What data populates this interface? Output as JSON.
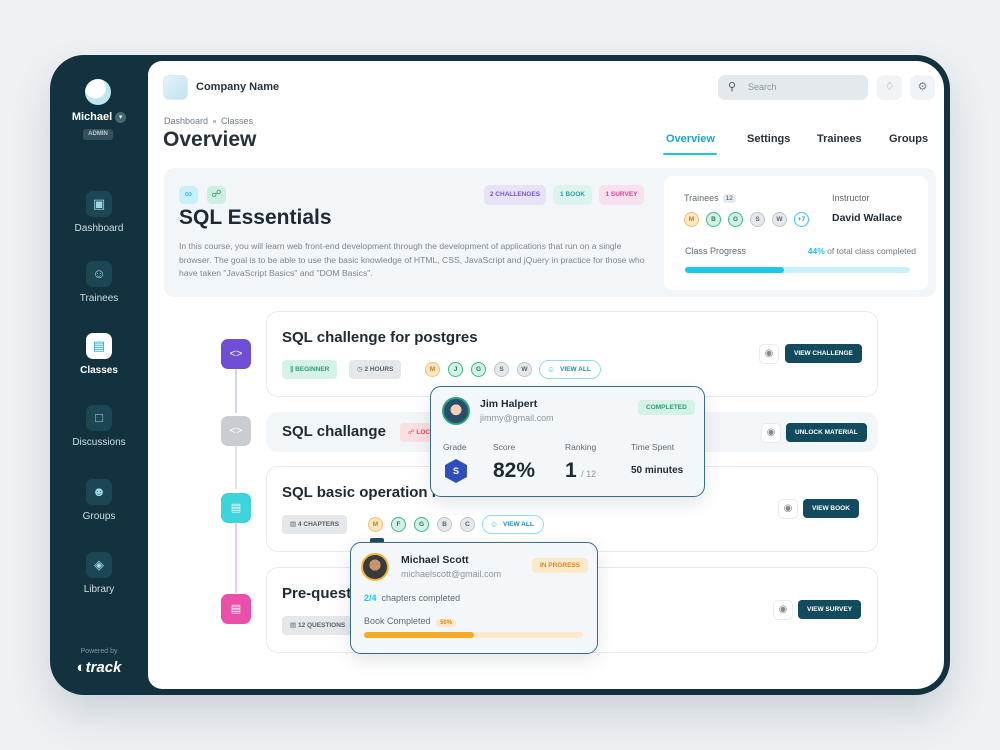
{
  "sidebar": {
    "user": {
      "name": "Michael",
      "role": "ADMIN"
    },
    "items": [
      {
        "label": "Dashboard",
        "icon": "kanban-icon",
        "active": false
      },
      {
        "label": "Trainees",
        "icon": "user-icon",
        "active": false
      },
      {
        "label": "Classes",
        "icon": "book-icon",
        "active": true
      },
      {
        "label": "Discussions",
        "icon": "chat-icon",
        "active": false
      },
      {
        "label": "Groups",
        "icon": "users-icon",
        "active": false
      },
      {
        "label": "Library",
        "icon": "layers-icon",
        "active": false
      }
    ],
    "powered_by": "Powered by",
    "brand": "track"
  },
  "header": {
    "company": "Company Name",
    "search_placeholder": "Search",
    "breadcrumb": [
      "Dashboard",
      "Classes"
    ],
    "title": "Overview",
    "tabs": [
      {
        "label": "Overview",
        "active": true
      },
      {
        "label": "Settings",
        "active": false
      },
      {
        "label": "Trainees",
        "active": false
      },
      {
        "label": "Groups",
        "active": false
      }
    ]
  },
  "course": {
    "title": "SQL Essentials",
    "description": "In this course, you will learn web front-end development through the development of applications that run on a single browser. The goal is to be able to use the basic knowledge of HTML, CSS, JavaScript and jQuery in practice for those who have taken \"JavaScript Basics\" and \"DOM Basics\".",
    "tags": [
      "2 CHALLENGES",
      "1 BOOK",
      "1 SURVEY"
    ],
    "trainees_label": "Trainees",
    "trainees_count": "12",
    "trainee_initials": [
      "M",
      "B",
      "G",
      "S",
      "W"
    ],
    "trainees_more": "+7",
    "instructor_label": "Instructor",
    "instructor": "David Wallace",
    "progress_label": "Class Progress",
    "progress_percent": "44%",
    "progress_suffix": "of total class completed",
    "progress_value": 44
  },
  "items": [
    {
      "title": "SQL challenge for postgres",
      "type": "challenge",
      "chips": [
        "BEGINNER",
        "2 HOURS"
      ],
      "initials": [
        "M",
        "J",
        "G",
        "S",
        "W"
      ],
      "view_all": "VIEW ALL",
      "action": "VIEW CHALLENGE"
    },
    {
      "title": "SQL challange",
      "type": "locked",
      "chips": [
        "LOCKED"
      ],
      "action": "UNLOCK MATERIAL"
    },
    {
      "title": "SQL basic operation read",
      "type": "book",
      "chips": [
        "4 CHAPTERS"
      ],
      "initials": [
        "M",
        "F",
        "G",
        "B",
        "C"
      ],
      "view_all": "VIEW ALL",
      "action": "VIEW BOOK"
    },
    {
      "title": "Pre-questionnaire",
      "type": "survey",
      "chips": [
        "12 QUESTIONS"
      ],
      "action": "VIEW SURVEY"
    }
  ],
  "popover_jim": {
    "name": "Jim Halpert",
    "email": "jimmy@gmail.com",
    "status": "COMPLETED",
    "grade_label": "Grade",
    "grade": "S",
    "score_label": "Score",
    "score": "82%",
    "ranking_label": "Ranking",
    "rank": "1",
    "rank_total": "/ 12",
    "time_label": "Time Spent",
    "time": "50 minutes"
  },
  "popover_michael": {
    "name": "Michael Scott",
    "email": "michaelscott@gmail.com",
    "status": "IN PRGRESS",
    "chapters_done": "2/4",
    "chapters_text": "chapters completed",
    "book_label": "Book Completed",
    "book_percent": "50%",
    "book_value": 50
  }
}
